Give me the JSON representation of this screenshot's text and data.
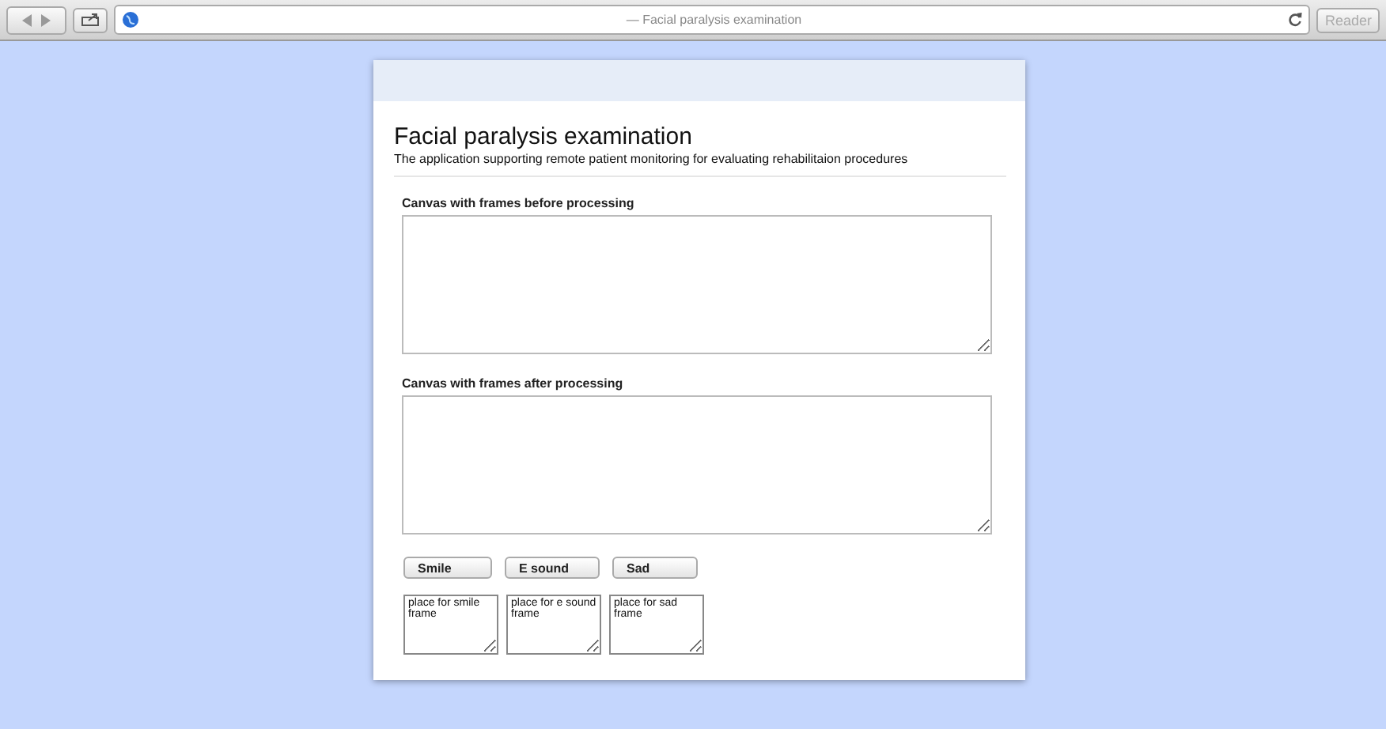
{
  "browser": {
    "title": "— Facial paralysis examination",
    "reader": "Reader"
  },
  "page": {
    "title": "Facial paralysis examination",
    "subtitle": "The application supporting remote patient monitoring for evaluating rehabilitaion procedures",
    "canvases": [
      {
        "label": "Canvas with frames before processing"
      },
      {
        "label": "Canvas with frames after processing"
      }
    ],
    "buttons": [
      {
        "label": "Smile"
      },
      {
        "label": "E sound"
      },
      {
        "label": "Sad"
      }
    ],
    "frames": [
      {
        "value": "place for smile frame"
      },
      {
        "value": "place for e sound frame"
      },
      {
        "value": "place for sad frame"
      }
    ]
  }
}
